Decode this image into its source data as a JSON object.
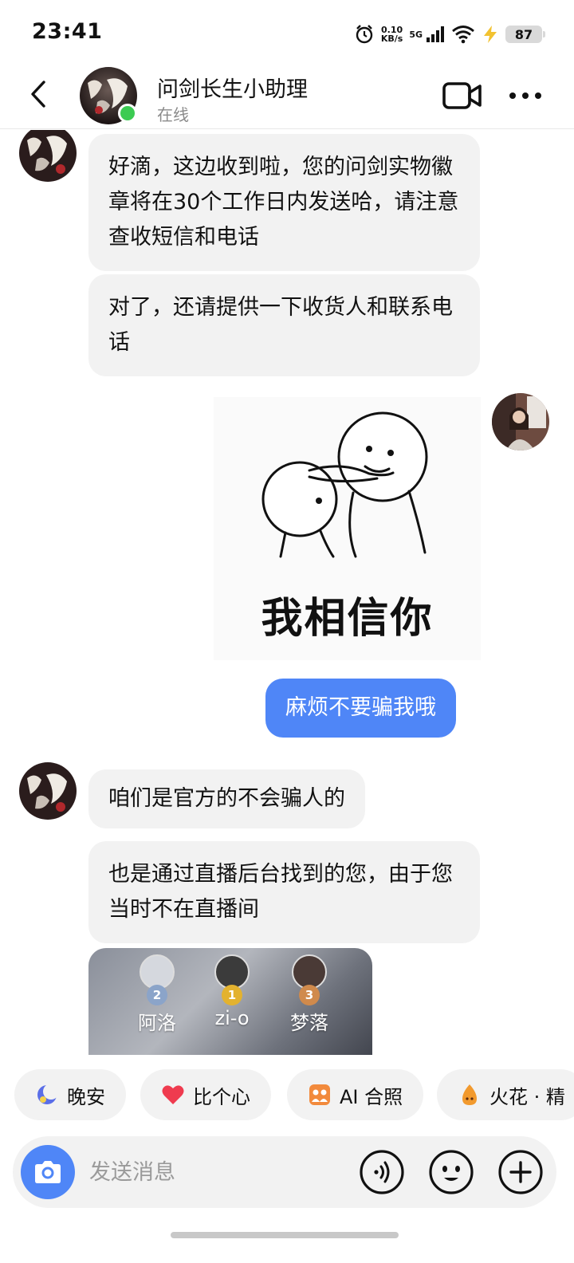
{
  "status_bar": {
    "time": "23:41",
    "net_speed_value": "0.10",
    "net_speed_unit": "KB/s",
    "network_type": "5G",
    "battery": "87",
    "icons": [
      "alarm-icon",
      "signal-icon",
      "wifi-icon",
      "battery-saver-icon"
    ]
  },
  "header": {
    "title": "问剑长生小助理",
    "status": "在线",
    "icons": [
      "back-icon",
      "video-call-icon",
      "more-icon"
    ]
  },
  "messages": [
    {
      "from": "other",
      "type": "text",
      "text": "好滴，这边收到啦，您的问剑实物徽章将在30个工作日内发送哈，请注意查收短信和电话"
    },
    {
      "from": "other",
      "type": "text",
      "text": "对了，还请提供一下收货人和联系电话"
    },
    {
      "from": "me",
      "type": "sticker",
      "caption": "我相信你"
    },
    {
      "from": "me",
      "type": "text",
      "text": "麻烦不要骗我哦"
    },
    {
      "from": "other",
      "type": "text",
      "text": "咱们是官方的不会骗人的"
    },
    {
      "from": "other",
      "type": "text",
      "text": "也是通过直播后台找到的您，由于您当时不在直播间"
    },
    {
      "from": "other",
      "type": "image",
      "ranking": [
        {
          "rank": "2",
          "name": "阿洛"
        },
        {
          "rank": "1",
          "name": "zi-o"
        },
        {
          "rank": "3",
          "name": "梦落"
        }
      ]
    }
  ],
  "quick_replies": [
    {
      "label": "晚安",
      "icon": "moon-icon"
    },
    {
      "label": "比个心",
      "icon": "heart-icon"
    },
    {
      "label": "AI 合照",
      "icon": "ai-photo-icon"
    },
    {
      "label": "火花 · 精",
      "icon": "spark-icon"
    }
  ],
  "input": {
    "placeholder": "发送消息",
    "icons": [
      "camera-icon",
      "voice-icon",
      "emoji-icon",
      "plus-icon"
    ]
  },
  "colors": {
    "accent": "#4f86f7",
    "bubble_other": "#f2f2f2",
    "online": "#3ccb52"
  }
}
